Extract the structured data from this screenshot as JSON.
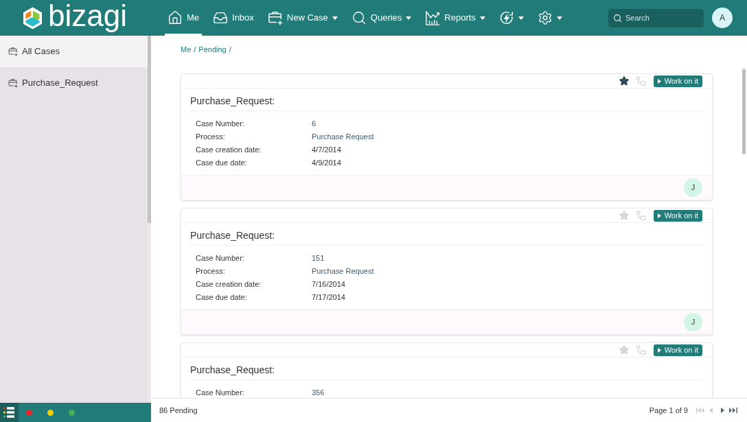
{
  "header": {
    "logo": "bizagi",
    "nav": [
      {
        "kind": "home",
        "label": "Me",
        "selected": true,
        "dropdown": false
      },
      {
        "kind": "inbox",
        "label": "Inbox",
        "selected": false,
        "dropdown": false
      },
      {
        "kind": "new-case",
        "label": "New Case",
        "selected": false,
        "dropdown": true
      },
      {
        "kind": "queries",
        "label": "Queries",
        "selected": false,
        "dropdown": true
      },
      {
        "kind": "reports",
        "label": "Reports",
        "selected": false,
        "dropdown": true
      },
      {
        "kind": "activity",
        "selected": false,
        "dropdown": true
      },
      {
        "kind": "settings",
        "selected": false,
        "dropdown": true
      }
    ],
    "search": {
      "placeholder": "Search"
    },
    "avatar": "A"
  },
  "sidebar": {
    "items": [
      {
        "label": "All Cases",
        "selected": true
      },
      {
        "label": "Purchase_Request",
        "selected": false
      }
    ]
  },
  "breadcrumb": [
    {
      "label": "Me",
      "separator": "/"
    },
    {
      "label": "Pending",
      "separator": "/"
    }
  ],
  "cards": [
    {
      "starred": true,
      "button": "Work on it",
      "title": "Purchase_Request:",
      "fields": [
        {
          "label": "Case Number:",
          "value": "6",
          "kind": "link"
        },
        {
          "label": "Process:",
          "value": "Purchase Request",
          "kind": "link"
        },
        {
          "label": "Case creation date:",
          "value": "4/7/2014",
          "kind": "text"
        },
        {
          "label": "Case due date:",
          "value": "4/9/2014",
          "kind": "text"
        }
      ],
      "assignee": "J"
    },
    {
      "starred": false,
      "button": "Work on it",
      "title": "Purchase_Request:",
      "fields": [
        {
          "label": "Case Number:",
          "value": "151",
          "kind": "link"
        },
        {
          "label": "Process:",
          "value": "Purchase Request",
          "kind": "link"
        },
        {
          "label": "Case creation date:",
          "value": "7/16/2014",
          "kind": "text"
        },
        {
          "label": "Case due date:",
          "value": "7/17/2014",
          "kind": "text"
        }
      ],
      "assignee": "J"
    },
    {
      "starred": false,
      "button": "Work on it",
      "title": "Purchase_Request:",
      "fields": [
        {
          "label": "Case Number:",
          "value": "356",
          "kind": "link"
        }
      ]
    }
  ],
  "status_bar": {
    "filters": [
      {
        "color": "#e8262b"
      },
      {
        "color": "#f0d000"
      },
      {
        "color": "#4caf50"
      }
    ],
    "count": "86 Pending",
    "page": "Page 1 of 9",
    "pager": [
      {
        "kind": "first",
        "disabled": true
      },
      {
        "kind": "prev",
        "disabled": true
      },
      {
        "kind": "next",
        "disabled": false
      },
      {
        "kind": "last",
        "disabled": false
      }
    ]
  }
}
